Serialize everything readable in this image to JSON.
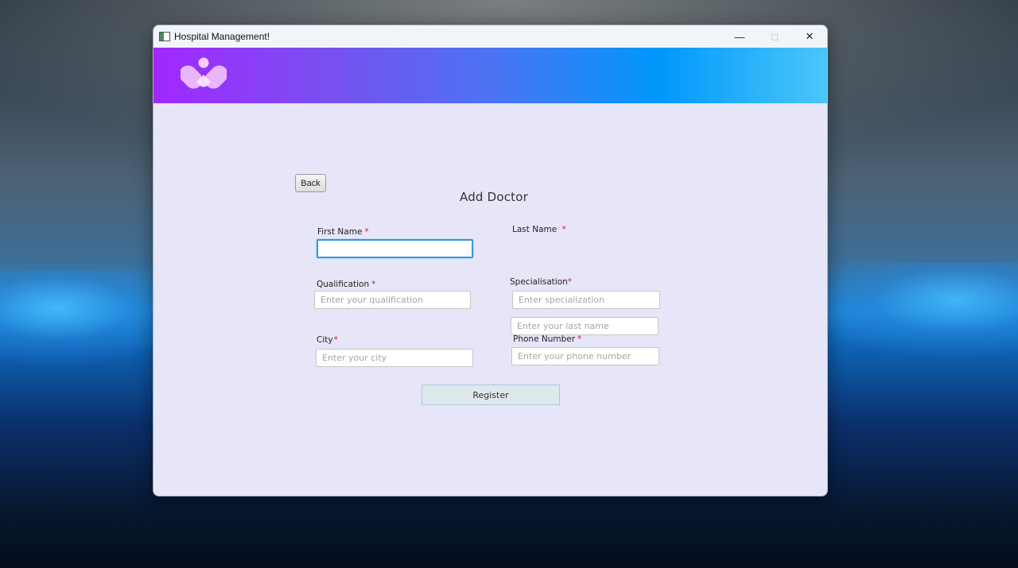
{
  "window": {
    "title": "Hospital Management!",
    "controls": {
      "minimize": "—",
      "maximize": "□",
      "close": "✕"
    }
  },
  "banner": {
    "gradient_colors": [
      "#a128ff",
      "#4c73f2",
      "#0097fb",
      "#4cc7f7"
    ],
    "logo_icon": "heart-hands-logo"
  },
  "form": {
    "back_label": "Back",
    "title": "Add Doctor",
    "required_marker": "*",
    "fields": {
      "first_name": {
        "label": "First Name",
        "placeholder": "",
        "value": ""
      },
      "last_name": {
        "label": "Last Name",
        "placeholder": "Enter your last name",
        "value": ""
      },
      "qualification": {
        "label": "Qualification",
        "placeholder": "Enter your qualification",
        "value": ""
      },
      "specialisation": {
        "label": "Specialisation",
        "placeholder": "Enter specialization",
        "value": ""
      },
      "city": {
        "label": "City",
        "placeholder": "Enter your city",
        "value": ""
      },
      "phone": {
        "label": "Phone Number",
        "placeholder": "Enter your phone number",
        "value": ""
      }
    },
    "register_label": "Register"
  },
  "colors": {
    "focus_border": "#3b94e0",
    "required": "#e01a1a",
    "content_background": "#e6e6f8"
  }
}
